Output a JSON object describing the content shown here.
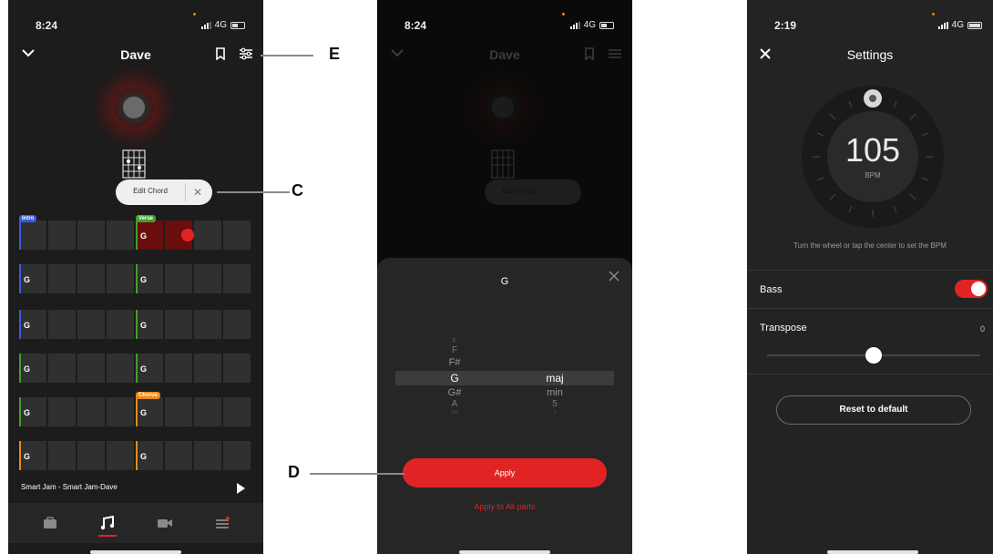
{
  "phone1": {
    "status": {
      "time": "8:24",
      "network": "4G"
    },
    "header": {
      "title": "Dave"
    },
    "popup": {
      "label": "Edit Chord",
      "close": "✕"
    },
    "sections": {
      "intro": "Intro",
      "verse": "Verse",
      "chorus": "Chorus"
    },
    "rows": [
      {
        "cells": [
          "",
          "",
          "",
          "",
          "G",
          "",
          "",
          ""
        ]
      },
      {
        "cells": [
          "G",
          "",
          "",
          "",
          "G",
          "",
          "",
          ""
        ]
      },
      {
        "cells": [
          "G",
          "",
          "",
          "",
          "G",
          "",
          "",
          ""
        ]
      },
      {
        "cells": [
          "G",
          "",
          "",
          "",
          "G",
          "",
          "",
          ""
        ]
      },
      {
        "cells": [
          "G",
          "",
          "",
          "",
          "G",
          "",
          "",
          ""
        ]
      },
      {
        "cells": [
          "G",
          "",
          "",
          "",
          "G",
          "",
          "",
          ""
        ]
      }
    ],
    "now_playing": "Smart Jam - Smart Jam-Dave",
    "tabs": [
      "briefcase-icon",
      "music-note-icon",
      "video-camera-icon",
      "menu-icon"
    ],
    "colors": {
      "intro": "#3a5bd9",
      "verse": "#3fa02a",
      "chorus": "#e8891a",
      "active": "#e02424"
    }
  },
  "phone2": {
    "status": {
      "time": "8:24",
      "network": "4G"
    },
    "header": {
      "title": "Dave"
    },
    "popup": {
      "label": "Edit Chord"
    },
    "sheet": {
      "chord": "G",
      "notes": [
        "E",
        "F",
        "F#",
        "G",
        "G#",
        "A",
        "A#"
      ],
      "selected_note": "G",
      "qualities": [
        "maj",
        "min",
        "5",
        "7"
      ],
      "selected_quality": "maj",
      "apply": "Apply",
      "apply_all": "Apply to All parts"
    }
  },
  "phone3": {
    "status": {
      "time": "2:19",
      "network": "4G"
    },
    "header": {
      "title": "Settings"
    },
    "bpm": {
      "value": "105",
      "unit": "BPM"
    },
    "hint": "Turn the wheel or tap the center to set the BPM",
    "bass": {
      "label": "Bass",
      "on": true
    },
    "transpose": {
      "label": "Transpose",
      "value": "0",
      "level": 0.5
    },
    "reset": "Reset to default"
  },
  "callouts": {
    "e": "E",
    "c": "C",
    "d": "D"
  }
}
